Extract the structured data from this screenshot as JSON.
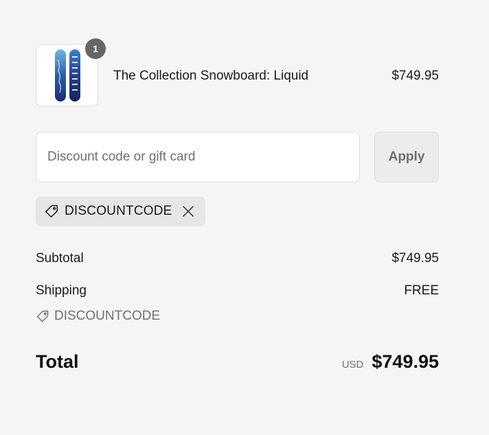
{
  "product": {
    "name": "The Collection Snowboard: Liquid",
    "price": "$749.95",
    "quantity": "1",
    "image_icon": "snowboard-image"
  },
  "discount": {
    "placeholder": "Discount code or gift card",
    "value": "",
    "apply_label": "Apply",
    "applied_code": "DISCOUNTCODE"
  },
  "summary": {
    "subtotal_label": "Subtotal",
    "subtotal_value": "$749.95",
    "shipping_label": "Shipping",
    "shipping_value": "FREE",
    "discount_code": "DISCOUNTCODE",
    "total_label": "Total",
    "currency": "USD",
    "total_value": "$749.95"
  },
  "colors": {
    "background": "#f5f5f5",
    "chip_background": "#e6e6e6",
    "badge": "#666666",
    "muted_text": "#707070"
  }
}
